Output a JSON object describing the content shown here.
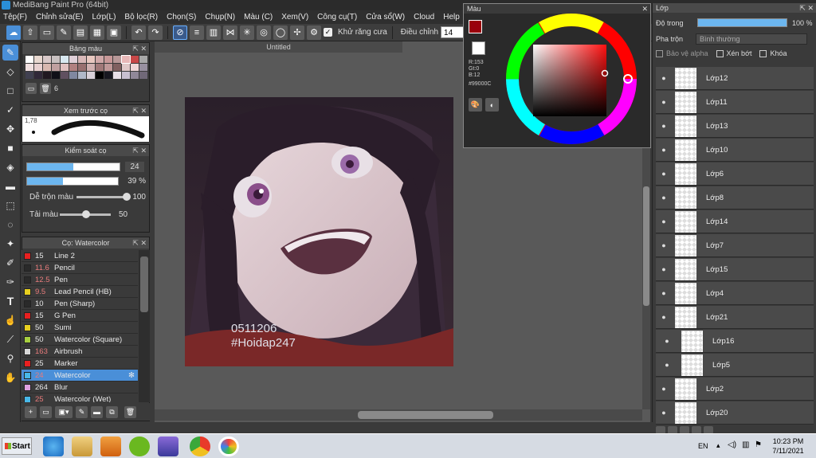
{
  "window": {
    "title": "MediBang Paint Pro (64bit)"
  },
  "menu": [
    "Tệp(F)",
    "Chỉnh sửa(E)",
    "Lớp(L)",
    "Bộ lọc(R)",
    "Chọn(S)",
    "Chụp(N)",
    "Màu (C)",
    "Xem(V)",
    "Công cụ(T)",
    "Cửa sổ(W)",
    "Cloud",
    "Help"
  ],
  "toolbar": {
    "antialias_label": "Khử răng cưa",
    "adjust_label": "Điều chỉnh",
    "adjust_value": "14"
  },
  "palette": {
    "title": "Bảng màu",
    "count": "6",
    "colors": [
      "#ffffff",
      "#e8d8d0",
      "#d8c8c8",
      "#c8c0c0",
      "#d8e8f0",
      "#e0d0d8",
      "#d8b8b8",
      "#e8c8c0",
      "#d0a8a8",
      "#c89898",
      "#b89898",
      "#e8b8b8",
      "#c84848",
      "#a8a8a8",
      "#f0e0e0",
      "#e8d0d0",
      "#d8b8b0",
      "#c0a0a0",
      "#e0c0c0",
      "#b08080",
      "#987070",
      "#d0b0b0",
      "#a07878",
      "#c09898",
      "#806060",
      "#e0c8c8",
      "#f0d8d8",
      "#9890a0",
      "#404050",
      "#302838",
      "#201820",
      "#101018",
      "#605060",
      "#8088a0",
      "#b0b8c8",
      "#d8d0d8",
      "#000000",
      "#181820",
      "#e8e0e8",
      "#c8c0d0",
      "#908898",
      "#706878"
    ]
  },
  "brush_preview": {
    "title": "Xem trước cọ",
    "size": "1,78"
  },
  "brush_control": {
    "title": "Kiểm soát cọ",
    "size_value": "24",
    "opacity_value": "39 %",
    "blend_label": "Dễ trộn màu",
    "blend_value": "100",
    "reload_label": "Tải màu",
    "reload_value": "50"
  },
  "brush_list": {
    "title": "Cọ: Watercolor",
    "items": [
      {
        "size": "15",
        "name": "Line 2",
        "color": "#e82020",
        "red": false
      },
      {
        "size": "11.6",
        "name": "Pencil",
        "color": "#2a2a2a",
        "red": true
      },
      {
        "size": "12.5",
        "name": "Pen",
        "color": "#2a2a2a",
        "red": true
      },
      {
        "size": "9.5",
        "name": "Lead Pencil (HB)",
        "color": "#e8d020",
        "red": true
      },
      {
        "size": "10",
        "name": "Pen (Sharp)",
        "color": "#2a2a2a",
        "red": false
      },
      {
        "size": "15",
        "name": "G Pen",
        "color": "#e82020",
        "red": false
      },
      {
        "size": "50",
        "name": "Sumi",
        "color": "#e8d020",
        "red": false
      },
      {
        "size": "50",
        "name": "Watercolor (Square)",
        "color": "#a8d040",
        "red": false
      },
      {
        "size": "163",
        "name": "Airbrush",
        "color": "#d8d8d8",
        "red": true
      },
      {
        "size": "25",
        "name": "Marker",
        "color": "#e82020",
        "red": false
      },
      {
        "size": "24",
        "name": "Watercolor",
        "color": "#48b8e8",
        "red": true
      },
      {
        "size": "264",
        "name": "Blur",
        "color": "#e0a0e0",
        "red": false
      },
      {
        "size": "25",
        "name": "Watercolor (Wet)",
        "color": "#48b8e8",
        "red": true
      }
    ]
  },
  "document": {
    "tab": "Untitled",
    "watermark_line1": "0511206",
    "watermark_line2": "#Hoidap247"
  },
  "color_window": {
    "title": "Màu",
    "r": "R:153",
    "g": "Gt:0",
    "b": "B:12",
    "hex": "#99000C",
    "primary": "#99000c"
  },
  "layers": {
    "title": "Lớp",
    "opacity_label": "Độ trong",
    "opacity_value": "100 %",
    "blend_label": "Pha trộn",
    "blend_value": "Bình thường",
    "protect_alpha": "Bảo vệ alpha",
    "clip": "Xén bớt",
    "lock": "Khóa",
    "items": [
      "Lớp12",
      "Lớp11",
      "Lớp13",
      "Lớp10",
      "Lớp6",
      "Lớp8",
      "Lớp14",
      "Lớp7",
      "Lớp15",
      "Lớp4",
      "Lớp21",
      "Lớp16",
      "Lớp5",
      "Lớp2",
      "Lớp20"
    ]
  },
  "taskbar": {
    "start": "Start",
    "lang": "EN",
    "time": "10:23 PM",
    "date": "7/11/2021"
  }
}
